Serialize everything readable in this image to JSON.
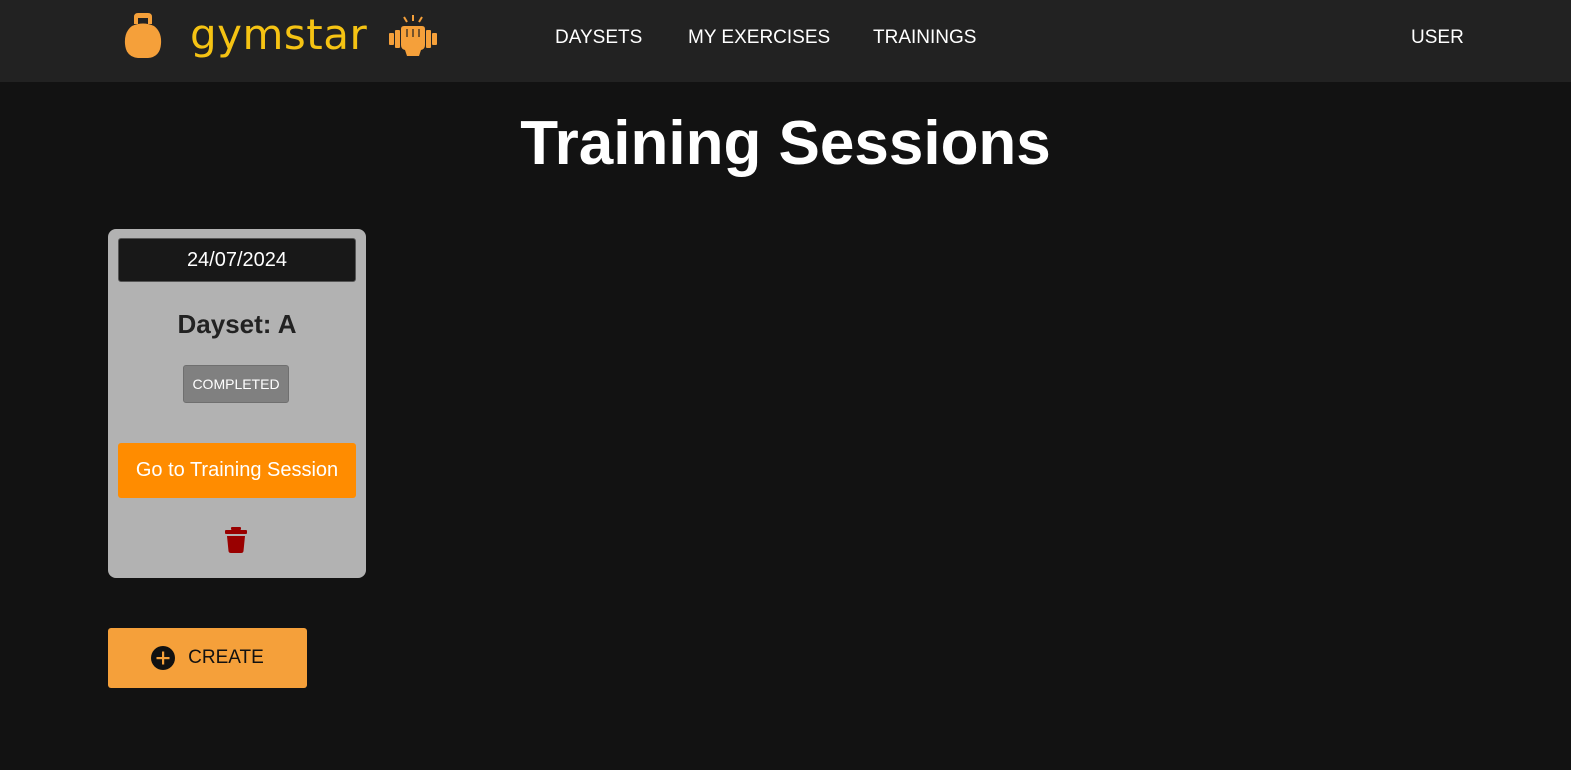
{
  "app": {
    "brand": "gymstar",
    "colors": {
      "brand_text": "#f5c313",
      "accent": "#ff8c00",
      "create_button": "#f5a03a",
      "delete_icon": "#990000",
      "status_badge": "#808080"
    }
  },
  "nav": {
    "links": [
      {
        "label": "DAYSETS"
      },
      {
        "label": "MY EXERCISES"
      },
      {
        "label": "TRAININGS"
      }
    ],
    "user_label": "USER"
  },
  "main": {
    "title": "Training Sessions",
    "sessions": [
      {
        "date": "24/07/2024",
        "dayset": "Dayset: A",
        "status": "COMPLETED",
        "go_label": "Go to Training Session",
        "delete_icon": "trash-icon"
      }
    ],
    "create_label": "CREATE",
    "create_icon": "plus-circle-icon"
  }
}
